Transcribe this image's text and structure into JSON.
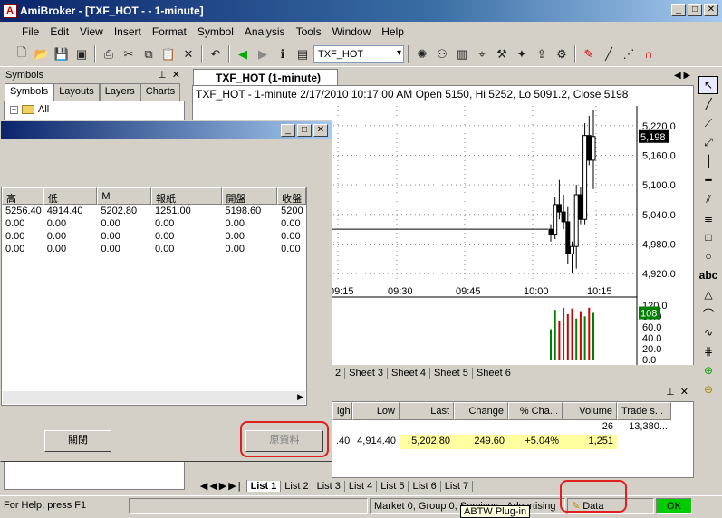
{
  "app": {
    "title": "AmiBroker - [TXF_HOT - - 1-minute]"
  },
  "menu": [
    "File",
    "Edit",
    "View",
    "Insert",
    "Format",
    "Symbol",
    "Analysis",
    "Tools",
    "Window",
    "Help"
  ],
  "toolbar": {
    "symbol_combo": "TXF_HOT"
  },
  "symbols_panel": {
    "title": "Symbols",
    "tabs": [
      "Symbols",
      "Layouts",
      "Layers",
      "Charts"
    ],
    "tree_root": "All"
  },
  "dialog": {
    "columns": [
      "高",
      "低",
      "M",
      "報紙",
      "開盤",
      "收盤"
    ],
    "rows": [
      [
        "5256.40",
        "4914.40",
        "5202.80",
        "1251.00",
        "5198.60",
        "5200"
      ],
      [
        "0.00",
        "0.00",
        "0.00",
        "0.00",
        "0.00",
        "0.00"
      ],
      [
        "0.00",
        "0.00",
        "0.00",
        "0.00",
        "0.00",
        "0.00"
      ],
      [
        "0.00",
        "0.00",
        "0.00",
        "0.00",
        "0.00",
        "0.00"
      ]
    ],
    "close_button": "關閉",
    "disabled_button": "原資料"
  },
  "chart": {
    "tab_label": "TXF_HOT (1-minute)",
    "caption": "TXF_HOT - 1-minute 2/17/2010 10:17:00 AM Open 5150, Hi 5252, Lo 5091.2, Close 5198",
    "last_price_label": "5,198",
    "volume_label": "108",
    "volume_axis_partial": "00"
  },
  "chart_data": [
    {
      "type": "candlestick",
      "title": "TXF_HOT - 1-minute 2/17/2010 10:17:00 AM Open 5150, Hi 5252, Lo 5091.2, Close 5198",
      "x_ticks": [
        "09:15",
        "09:30",
        "09:45",
        "10:00",
        "10:15"
      ],
      "y_ticks": [
        "5,220.0",
        "5,160.0",
        "5,100.0",
        "5,040.0",
        "4,980.0",
        "4,920.0"
      ],
      "ylim": [
        4900,
        5260
      ],
      "grid": true,
      "candles": [
        {
          "o": 5010,
          "h": 5020,
          "l": 4985,
          "c": 5000
        },
        {
          "o": 5000,
          "h": 5075,
          "l": 4990,
          "c": 5060
        },
        {
          "o": 5060,
          "h": 5110,
          "l": 5030,
          "c": 5045
        },
        {
          "o": 5045,
          "h": 5080,
          "l": 5010,
          "c": 5025
        },
        {
          "o": 5025,
          "h": 5055,
          "l": 4940,
          "c": 4960
        },
        {
          "o": 4960,
          "h": 4985,
          "l": 4920,
          "c": 4975
        },
        {
          "o": 4975,
          "h": 5100,
          "l": 4930,
          "c": 5080
        },
        {
          "o": 5080,
          "h": 5095,
          "l": 5020,
          "c": 5030
        },
        {
          "o": 5030,
          "h": 5225,
          "l": 5020,
          "c": 5200
        },
        {
          "o": 5200,
          "h": 5240,
          "l": 5140,
          "c": 5150
        },
        {
          "o": 5150,
          "h": 5252,
          "l": 5091.2,
          "c": 5198
        }
      ]
    },
    {
      "type": "bar",
      "y_ticks": [
        "120.0",
        "80.0",
        "60.0",
        "40.0",
        "20.0",
        "0.0"
      ],
      "ylim": [
        0,
        130
      ],
      "values": [
        70,
        115,
        90,
        120,
        105,
        118,
        95,
        112,
        100,
        120,
        108
      ],
      "colors": [
        "#008000",
        "#008000",
        "#d00000",
        "#008000",
        "#d00000",
        "#d00000",
        "#008000",
        "#d00000",
        "#008000",
        "#d00000",
        "#008000"
      ]
    }
  ],
  "sheets": [
    "2",
    "Sheet 3",
    "Sheet 4",
    "Sheet 5",
    "Sheet 6"
  ],
  "quote_list": {
    "columns": [
      "igh",
      "Low",
      "Last",
      "Change",
      "% Cha...",
      "Volume",
      "Trade s..."
    ],
    "rows": [
      [
        "",
        "",
        "",
        "",
        "",
        "26",
        "13,380..."
      ],
      [
        ".40",
        "4,914.40",
        "5,202.80",
        "249.60",
        "+5.04%",
        "1,251",
        ""
      ]
    ]
  },
  "lists": [
    "List 1",
    "List 2",
    "List 3",
    "List 4",
    "List 5",
    "List 6",
    "List 7"
  ],
  "status": {
    "help": "For Help, press F1",
    "market": "Market 0, Group 0, Services - Advertising",
    "data": "Data",
    "ok": "OK",
    "tooltip": "ABTW Plug-in"
  },
  "colors": {
    "accent_title": "#0a246a",
    "highlight_oval": "#e02020",
    "ok_green": "#00cc00"
  }
}
